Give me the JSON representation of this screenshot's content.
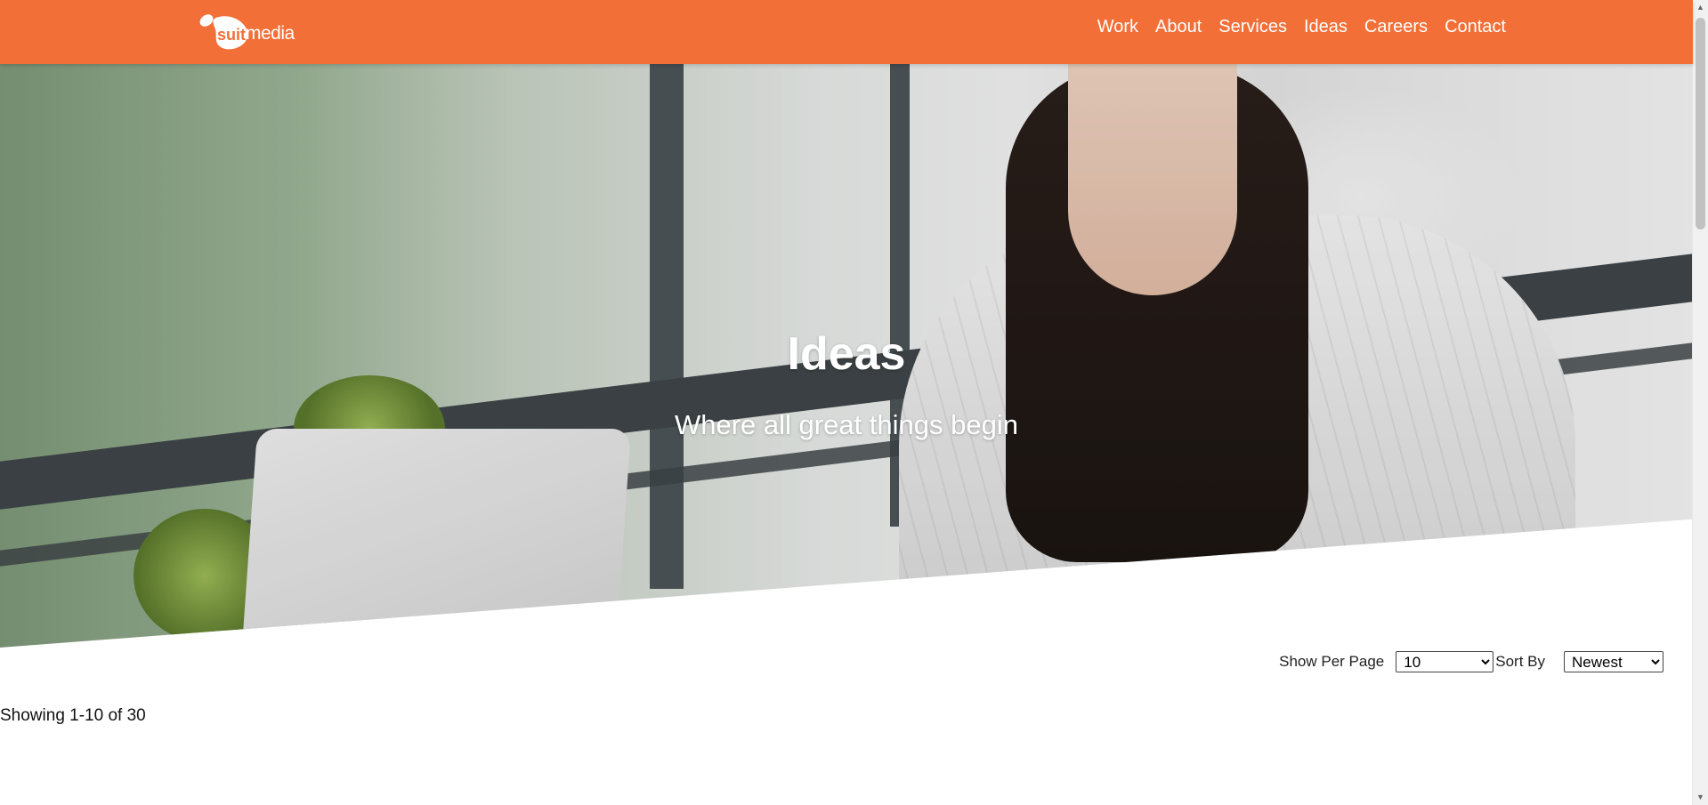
{
  "brand": {
    "name_bold": "suit",
    "name_light": "media",
    "color": "#f26f38"
  },
  "nav": {
    "items": [
      {
        "label": "Work"
      },
      {
        "label": "About"
      },
      {
        "label": "Services"
      },
      {
        "label": "Ideas"
      },
      {
        "label": "Careers"
      },
      {
        "label": "Contact"
      }
    ]
  },
  "hero": {
    "title": "Ideas",
    "subtitle": "Where all great things begin"
  },
  "controls": {
    "per_page_label": "Show Per Page",
    "per_page_selected": "10",
    "sort_label": "Sort By",
    "sort_selected": "Newest"
  },
  "listing": {
    "showing_text": "Showing 1-10 of 30"
  },
  "icons": {
    "scroll_up": "arrow-up-icon",
    "scroll_down": "arrow-down-icon",
    "select_arrow": "chevron-down-icon"
  }
}
